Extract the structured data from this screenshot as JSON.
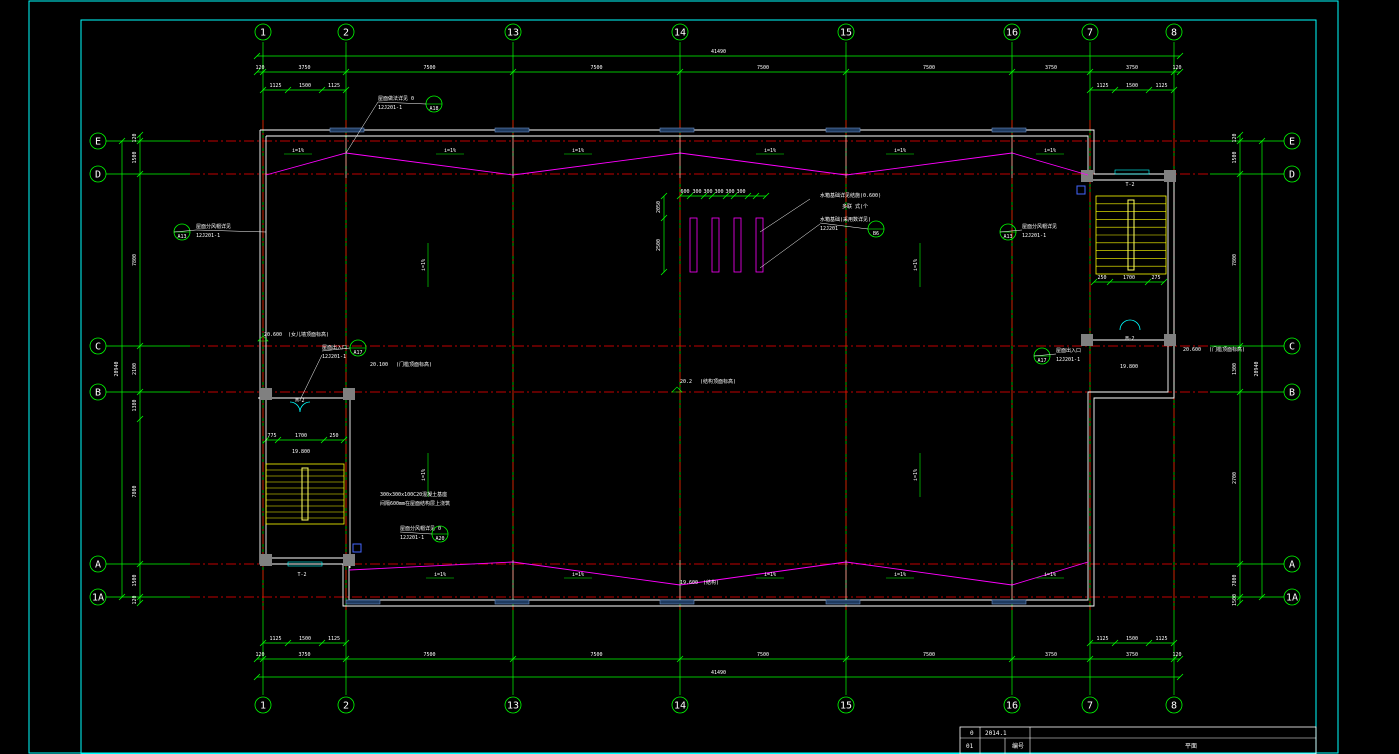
{
  "drawing": {
    "axes_vertical": [
      "1",
      "2",
      "13",
      "14",
      "15",
      "16",
      "7",
      "8"
    ],
    "axes_horizontal": [
      "E",
      "D",
      "C",
      "B",
      "A",
      "1A"
    ],
    "overall_width": "41490",
    "overall_depth": "20940",
    "dims_top_row1": [
      "120",
      "3750",
      "7500",
      "7500",
      "7500",
      "7500",
      "3750",
      "3750",
      "120"
    ],
    "dims_top_row2_left": [
      "1125",
      "1500",
      "1125"
    ],
    "dims_top_row2_right": [
      "1125",
      "1500",
      "1125"
    ],
    "dims_bottom_row1": [
      "120",
      "3750",
      "7500",
      "7500",
      "7500",
      "7500",
      "3750",
      "3750",
      "120"
    ],
    "dims_bottom_row2_left": [
      "1125",
      "1500",
      "1125"
    ],
    "dims_bottom_row2_right": [
      "1125",
      "1500",
      "1125"
    ],
    "dims_left": [
      "120",
      "1500",
      "7800",
      "2100",
      "1380",
      "7800",
      "1500",
      "120"
    ],
    "dims_right": [
      "120",
      "1500",
      "7800",
      "1300",
      "2700",
      "7800",
      "1500",
      "120",
      "250"
    ],
    "slope_labels": [
      "i=1%",
      "i=1%",
      "i=1%",
      "i=1%",
      "i=1%",
      "i=1%"
    ],
    "slope_vertical": [
      "i=1%",
      "i=1%",
      "i=1%",
      "i=1%"
    ],
    "annotations": {
      "top_detail": "屋面做法详见 0",
      "top_detail_ref": "12J201-1",
      "top_detail_sheet": "A18",
      "left_detail": "屋面分风帽详见",
      "left_detail_ref": "12J201-1",
      "left_detail_sheet": "A13",
      "right_detail": "屋面分风帽详见",
      "right_detail_ref": "12J201-1",
      "right_detail_sheet": "A13",
      "left_elev": "20.600",
      "left_elev_note": "(女儿墙顶面标高)",
      "left_entry": "屋面出入口",
      "left_entry_ref": "12J201-1",
      "left_entry_sheet": "A17",
      "left_door_elev": "20.100",
      "left_door_note": "(门槛顶面标高)",
      "mid_elev": "20.2",
      "mid_note": "(结构顶面标高)",
      "right_entry": "屋面出入口",
      "right_entry_ref": "12J201-1",
      "right_entry_sheet": "A17",
      "right_elev": "20.600",
      "right_elev_note": "(门槛顶面标高)",
      "right_stair_elev": "19.800",
      "left_stair_elev": "19.800",
      "water_note": "水箱基础详见结施(0.600)",
      "water_note2": "多联 式(个",
      "water_note3": "水箱基础(采用数详见)",
      "water_ref": "12J201",
      "water_sheet": "B6",
      "rain_note": "屋面分风帽详见 0",
      "rain_ref": "12J201-1",
      "rain_sheet": "A20",
      "pipe_note": "300x300x100C20混凝土基座",
      "pipe_note2": "间隔600mm在屋面结构层上浇筑",
      "bottom_elev": "19.600",
      "bottom_note": "(结构)",
      "stair_label_left": "T-2",
      "stair_label_right": "T-2",
      "door_left": "M-2",
      "door_right": "M-2",
      "small_dims_water": [
        "600",
        "300",
        "300",
        "300",
        "300",
        "300"
      ],
      "small_dims_water_v": [
        "2050",
        "2500"
      ],
      "stair_dims_right": [
        "275",
        "275",
        "130",
        "250",
        "1700",
        "275",
        "250"
      ],
      "stair_dims_left": [
        "775",
        "1700",
        "250",
        "130",
        "275",
        "275"
      ]
    }
  },
  "title_block": {
    "row1": [
      "0",
      "2014.1"
    ],
    "row2": [
      "01",
      "编号",
      "平面"
    ]
  },
  "colors": {
    "background": "#000000",
    "border": "#00ffff",
    "axis": "#ff0000",
    "dim": "#00ff00",
    "wall": "#ffffff",
    "slope": "#ff00ff",
    "stair": "#ffff00",
    "column": "#808080"
  }
}
